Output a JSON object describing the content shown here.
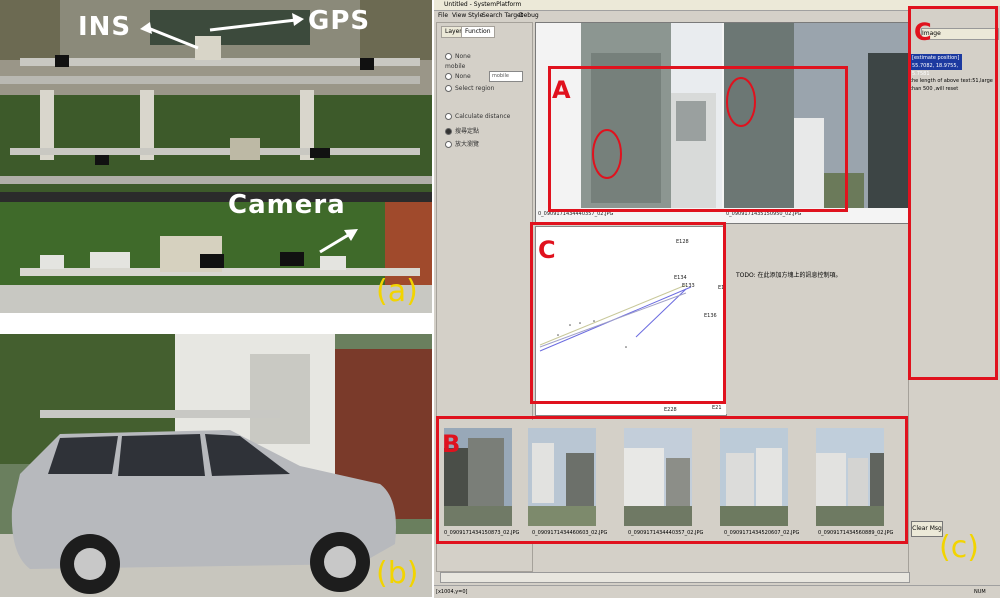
{
  "panel_a": {
    "labels": {
      "ins": "INS",
      "gps": "GPS",
      "camera": "Camera"
    },
    "panel_tag": "(a)"
  },
  "panel_b": {
    "panel_tag": "(b)"
  },
  "app": {
    "title": "Untitled - SystemPlatform",
    "menu": [
      "File",
      "View Style",
      "Search Target",
      "Debug"
    ],
    "tabs": [
      "Layer",
      "Function"
    ],
    "options": [
      "None",
      "mobile",
      "None",
      "Select region",
      "Calculate distance",
      "搜尋定點",
      "放大瀏覽"
    ],
    "dropdown_value": "mobile",
    "viewer_captions": [
      "0_0909171434440357_02.JPG",
      "0_0909171435150950_02.JPG"
    ],
    "plot_labels": [
      "E128",
      "E136",
      "E134",
      "E133",
      "E1",
      "E136",
      "E228",
      "E21"
    ],
    "todo_text": "TODO: 在此添加方塊上的訊息控制項。",
    "right_tab": "Image",
    "position_line1": "[estimate position]",
    "position_line2": "55.7082, 18.9755, 5.7581",
    "log_text": "the length of above text:51,large than 500 ,will reset",
    "clear_button": "Clear Msg",
    "status_left": "[x1004,y=0]",
    "status_right": "NUM",
    "thumb_captions": [
      "0_0909171434150873_02.JPG",
      "0_0909171434460603_02.JPG",
      "0_0909171434440357_02.JPG",
      "0_0909171434520607_02.JPG",
      "0_0909171434560889_02.JPG"
    ],
    "panel_tag": "(c)",
    "region_letters": {
      "a": "A",
      "b": "B",
      "c": "C",
      "c2": "C"
    }
  }
}
